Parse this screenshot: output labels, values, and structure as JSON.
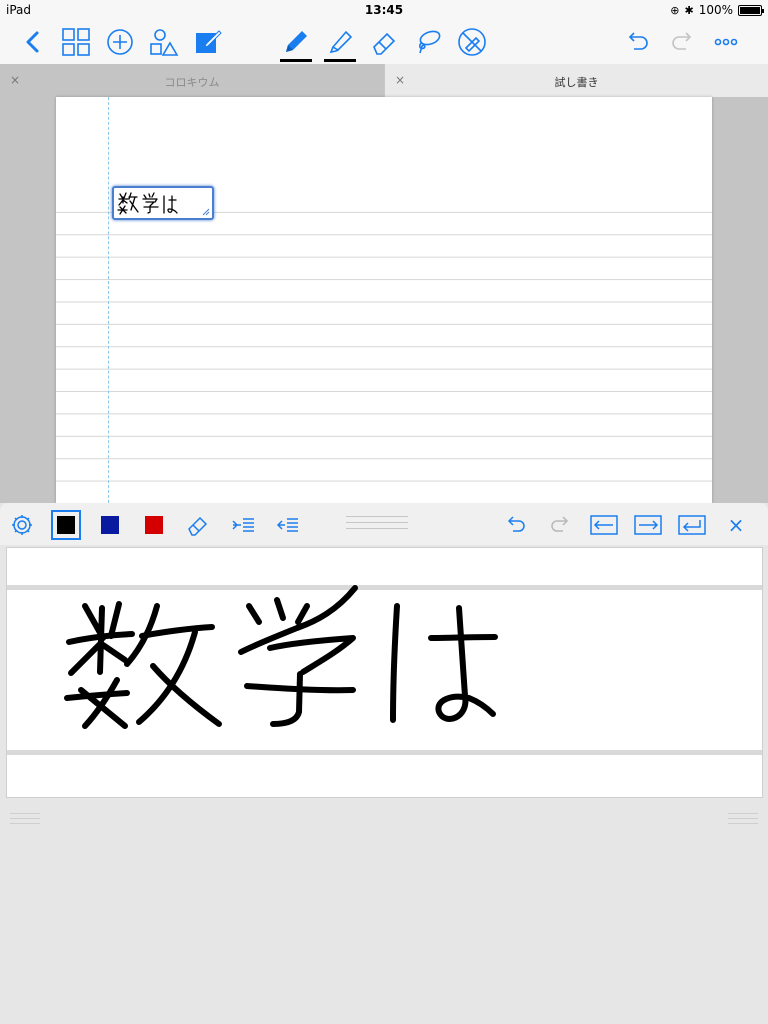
{
  "status_bar": {
    "device": "iPad",
    "time": "13:45",
    "battery": "100%"
  },
  "toolbar": {
    "icons": [
      "back-icon",
      "grid-icon",
      "add-icon",
      "shapes-icon",
      "compose-icon",
      "pen-icon",
      "highlighter-icon",
      "eraser-icon",
      "lasso-icon",
      "disable-pen-icon",
      "undo-icon",
      "redo-icon",
      "more-icon"
    ],
    "accent_color": "#1a7ef0"
  },
  "tabs": [
    {
      "label": "コロキウム",
      "active": false
    },
    {
      "label": "試し書き",
      "active": true
    }
  ],
  "tab_close_glyph": "×",
  "document": {
    "text_box_content": "数学は"
  },
  "handwriting_panel": {
    "colors": [
      {
        "name": "black",
        "hex": "#000000",
        "selected": true
      },
      {
        "name": "blue",
        "hex": "#0a1aa0",
        "selected": false
      },
      {
        "name": "red",
        "hex": "#d40000",
        "selected": false
      }
    ],
    "buttons": [
      "settings-icon",
      "eraser-icon",
      "indent-icon",
      "outdent-icon",
      "undo-icon",
      "redo-icon",
      "arrow-left-icon",
      "arrow-right-icon",
      "return-icon",
      "close-icon"
    ],
    "close_glyph": "×",
    "ink_text": "数学は"
  }
}
